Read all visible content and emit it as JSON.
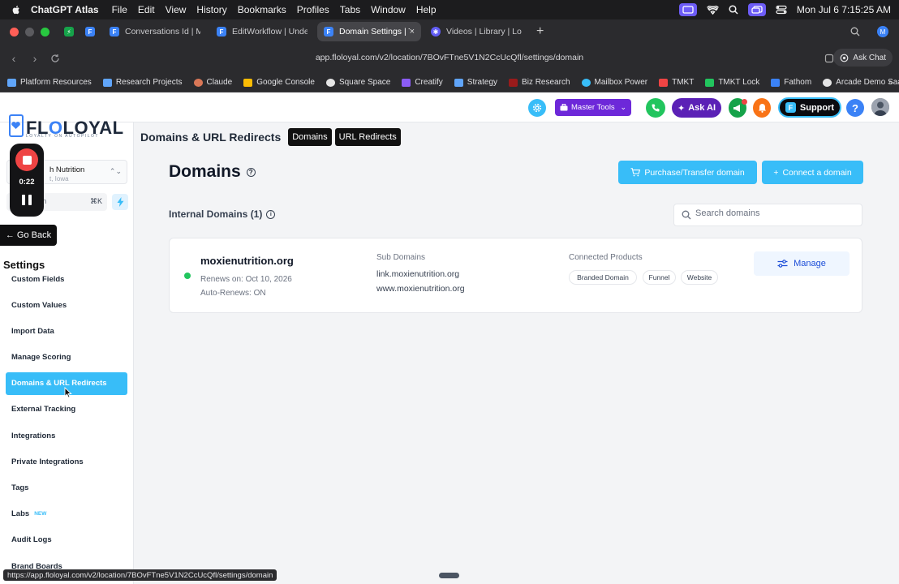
{
  "menubar": {
    "app": "ChatGPT Atlas",
    "items": [
      "File",
      "Edit",
      "View",
      "History",
      "Bookmarks",
      "Profiles",
      "Tabs",
      "Window",
      "Help"
    ],
    "clock": "Mon Jul 6  7:15:25 AM"
  },
  "tabs": [
    {
      "title": "",
      "icon": "floloyal-favicon",
      "color": "#3b82f6",
      "small": true
    },
    {
      "title": "Conversations Id | Mar",
      "icon": "floloyal-favicon",
      "color": "#3b82f6"
    },
    {
      "title": "EditWorkflow | Undefin",
      "icon": "floloyal-favicon",
      "color": "#3b82f6"
    },
    {
      "title": "Domain Settings | Trus",
      "icon": "floloyal-favicon",
      "color": "#3b82f6",
      "active": true
    },
    {
      "title": "Videos | Library | Loom",
      "icon": "loom-favicon",
      "color": "#625df5"
    }
  ],
  "address": {
    "url": "app.floloyal.com/v2/location/7BOvFTne5V1N2CcUcQfl/settings/domain",
    "ask_chat": "Ask Chat"
  },
  "bookmarks": [
    {
      "label": "Platform Resources",
      "color": "#60a5fa"
    },
    {
      "label": "Research Projects",
      "color": "#60a5fa"
    },
    {
      "label": "Claude",
      "color": "#d97757"
    },
    {
      "label": "Google Console",
      "color": "#fbbc04"
    },
    {
      "label": "Square Space",
      "color": "#e5e5e5"
    },
    {
      "label": "Creatify",
      "color": "#8b5cf6"
    },
    {
      "label": "Strategy",
      "color": "#60a5fa"
    },
    {
      "label": "Biz Research",
      "color": "#991b1b"
    },
    {
      "label": "Mailbox Power",
      "color": "#38bdf8"
    },
    {
      "label": "TMKT",
      "color": "#ef4444"
    },
    {
      "label": "TMKT Lock",
      "color": "#22c55e"
    },
    {
      "label": "Fathom",
      "color": "#3b82f6"
    },
    {
      "label": "Arcade Demo SaaS",
      "color": "#e5e5e5"
    }
  ],
  "topbar": {
    "master_tools": "Master Tools",
    "ask_ai": "Ask AI",
    "support": "Support",
    "help": "?"
  },
  "header": {
    "title": "Domains & URL Redirects",
    "tabs": [
      "Domains",
      "URL Redirects"
    ]
  },
  "brand": {
    "name_a": "FL",
    "name_b": "LOYAL",
    "tagline": "LOYALTY ON AUTOPILOT"
  },
  "location": {
    "name": "h Nutrition",
    "city": "t, Iowa"
  },
  "sidebar_search": {
    "placeholder": "h",
    "shortcut": "⌘K"
  },
  "recorder": {
    "time": "0:22"
  },
  "sidebar": {
    "go_back": "Go Back",
    "heading": "Settings",
    "items": [
      {
        "label": "Custom Fields"
      },
      {
        "label": "Custom Values"
      },
      {
        "label": "Import Data"
      },
      {
        "label": "Manage Scoring"
      },
      {
        "label": "Domains & URL Redirects",
        "active": true
      },
      {
        "label": "External Tracking"
      },
      {
        "label": "Integrations"
      },
      {
        "label": "Private Integrations"
      },
      {
        "label": "Tags"
      },
      {
        "label": "Labs",
        "badge": "NEW"
      },
      {
        "label": "Audit Logs"
      },
      {
        "label": "Brand Boards"
      }
    ]
  },
  "main": {
    "title": "Domains",
    "purchase_btn": "Purchase/Transfer domain",
    "connect_btn": "Connect a domain",
    "section": "Internal Domains (1)",
    "search_placeholder": "Search domains",
    "domain": {
      "name": "moxienutrition.org",
      "renews": "Renews on: Oct 10, 2026",
      "auto_renews": "Auto-Renews: ON",
      "sub_label": "Sub Domains",
      "subdomains": [
        "link.moxienutrition.org",
        "www.moxienutrition.org"
      ],
      "products_label": "Connected Products",
      "products": [
        "Branded Domain",
        "Funnel",
        "Website"
      ],
      "manage": "Manage"
    }
  },
  "status_url": "https://app.floloyal.com/v2/location/7BOvFTne5V1N2CcUcQfl/settings/domain",
  "colors": {
    "accent": "#38bdf8",
    "purple": "#6d28d9",
    "active_dot": "#22c55e"
  }
}
